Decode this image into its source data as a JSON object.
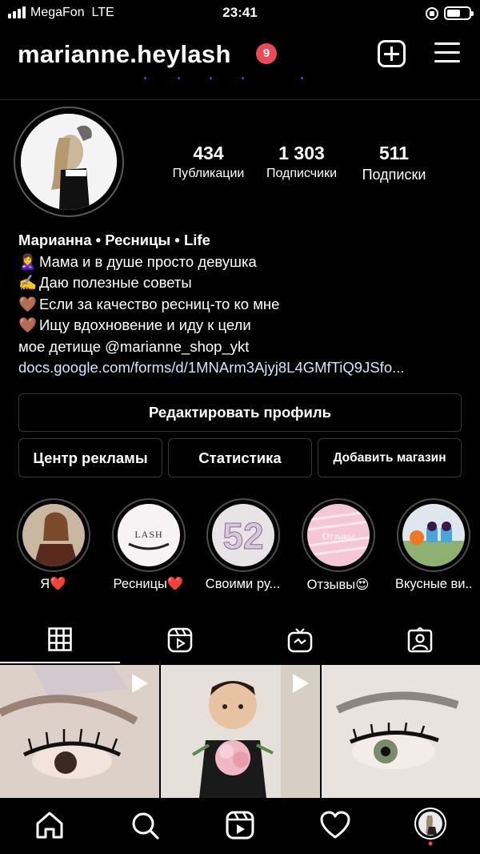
{
  "status_bar": {
    "carrier": "MegaFon",
    "network": "LTE",
    "time": "23:41",
    "battery_level": 0.6
  },
  "header": {
    "username": "marianne.heylash",
    "notification_count": "9"
  },
  "profile": {
    "stats": [
      {
        "value": "434",
        "label": "Публикации"
      },
      {
        "value": "1 303",
        "label": "Подписчики"
      },
      {
        "value": "511",
        "label": "Подписки"
      }
    ],
    "bio": {
      "name": "Марианна • Ресницы • Life",
      "lines": [
        {
          "emoji": "🙎‍♀️",
          "text": "Мама и в душе просто девушка"
        },
        {
          "emoji": "✍️",
          "text": "Даю полезные советы"
        },
        {
          "emoji": "🤎",
          "text": "Если за качество ресниц-то ко мне"
        },
        {
          "emoji": "🤎",
          "text": "Ищу вдохновение и иду к цели"
        }
      ],
      "shop_line": "мое детище @marianne_shop_ykt",
      "link": "docs.google.com/forms/d/1MNArm3Ajyj8L4GMfTiQ9JSfo..."
    }
  },
  "buttons": {
    "edit_profile": "Редактировать профиль",
    "ad_center": "Центр рекламы",
    "statistics": "Статистика",
    "add_shop": "Добавить магазин"
  },
  "highlights": [
    {
      "label": "Я❤️"
    },
    {
      "label": "Ресницы❤️"
    },
    {
      "label": "Своими ру..."
    },
    {
      "label": "Отзывы😍"
    },
    {
      "label": "Вкусные ви..."
    }
  ],
  "highlight_text": {
    "lash": "LASH",
    "reviews": "Отзывы",
    "number": "52"
  },
  "tabs": [
    {
      "icon": "grid-icon",
      "active": true
    },
    {
      "icon": "reels-icon",
      "active": false
    },
    {
      "icon": "igtv-icon",
      "active": false
    },
    {
      "icon": "tagged-icon",
      "active": false
    }
  ],
  "nav": [
    {
      "icon": "home-icon"
    },
    {
      "icon": "search-icon"
    },
    {
      "icon": "reels-icon"
    },
    {
      "icon": "heart-icon"
    },
    {
      "icon": "profile-avatar-icon"
    }
  ],
  "colors": {
    "background": "#000000",
    "badge": "#ed4956",
    "link": "#d3e4ff",
    "border": "#363636"
  }
}
